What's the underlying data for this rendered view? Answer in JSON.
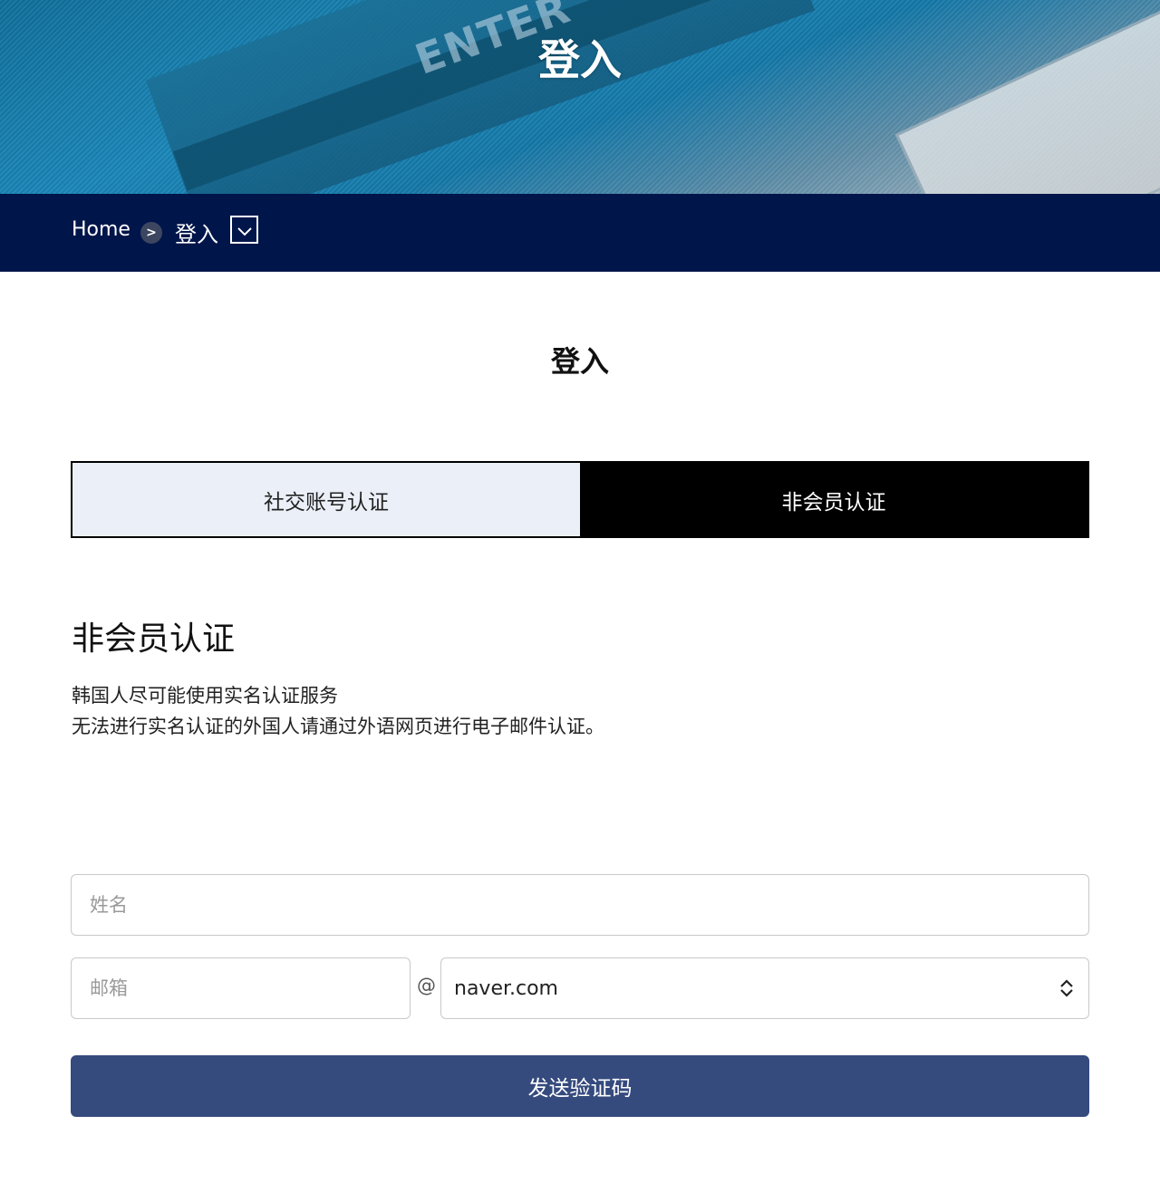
{
  "hero": {
    "decor_text": "ENTER",
    "title": "登入"
  },
  "breadcrumb": {
    "home": "Home",
    "separator": ">",
    "current": "登入"
  },
  "page": {
    "title": "登入"
  },
  "tabs": [
    {
      "label": "社交账号认证",
      "active": false
    },
    {
      "label": "非会员认证",
      "active": true
    }
  ],
  "section": {
    "title": "非会员认证",
    "desc_line1": "韩国人尽可能使用实名认证服务",
    "desc_line2": "无法进行实名认证的外国人请通过外语网页进行电子邮件认证。"
  },
  "form": {
    "name_placeholder": "姓名",
    "email_placeholder": "邮箱",
    "at": "@",
    "domain_selected": "naver.com",
    "submit_label": "发送验证码"
  },
  "colors": {
    "breadcrumb_bg": "#00154a",
    "tab_inactive_bg": "#ebf0f8",
    "tab_active_bg": "#000000",
    "button_bg": "#354a7d"
  }
}
